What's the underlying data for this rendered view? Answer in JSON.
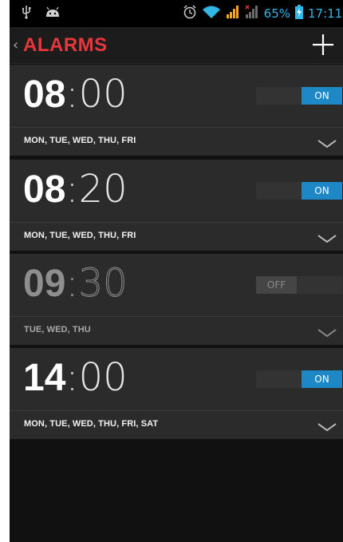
{
  "status_bar": {
    "battery_percent": "65%",
    "clock": "17:11",
    "icons": [
      "usb-icon",
      "android-debug-icon",
      "alarm-clock-icon",
      "wifi-icon",
      "signal-icon",
      "signal-roaming-icon",
      "battery-charging-icon"
    ]
  },
  "action_bar": {
    "back_glyph": "‹",
    "title": "ALARMS",
    "add_icon": "plus-icon"
  },
  "alarms": [
    {
      "hour": "08",
      "separator": ":",
      "minute": "00",
      "state": "ON",
      "days": "MON, TUE, WED, THU, FRI",
      "enabled": true
    },
    {
      "hour": "08",
      "separator": ":",
      "minute": "20",
      "state": "ON",
      "days": "MON, TUE, WED, THU, FRI",
      "enabled": true
    },
    {
      "hour": "09",
      "separator": ":",
      "minute": "30",
      "state": "OFF",
      "days": "TUE, WED, THU",
      "enabled": false
    },
    {
      "hour": "14",
      "separator": ":",
      "minute": "00",
      "state": "ON",
      "days": "MON, TUE, WED, THU, FRI, SAT",
      "enabled": true
    }
  ],
  "colors": {
    "accent_title": "#e8363b",
    "toggle_on": "#1e88c7",
    "status_text": "#31b6e7",
    "background": "#111111",
    "card": "#2b2b2b"
  }
}
